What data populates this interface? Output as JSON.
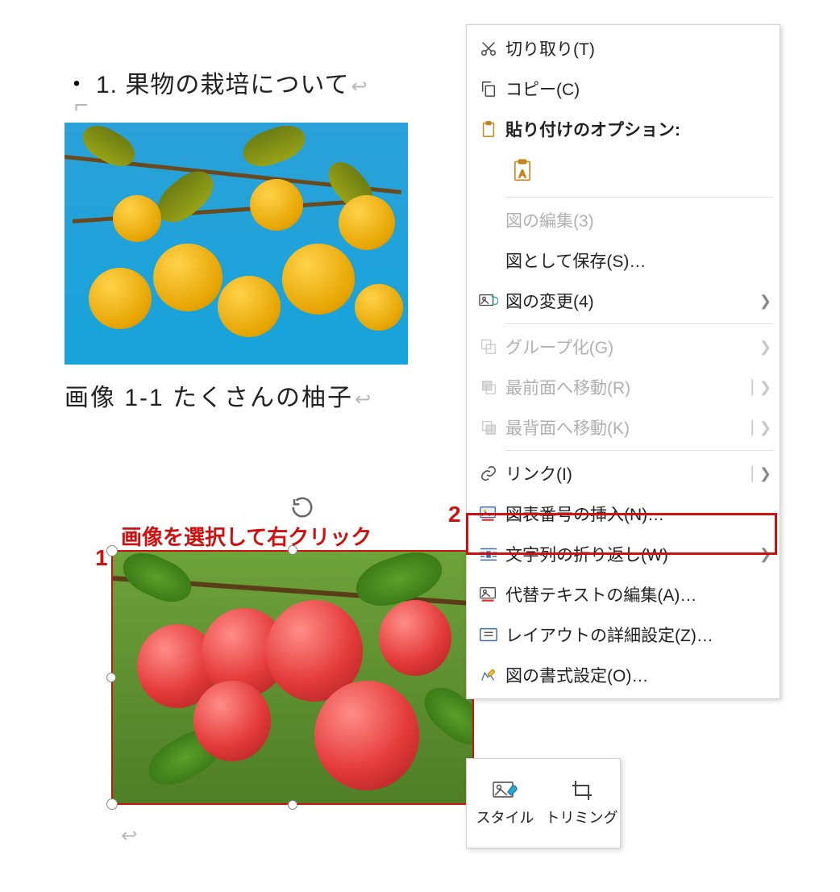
{
  "doc": {
    "heading_text": "1. 果物の栽培について",
    "caption_text": "画像  1-1 たくさんの柚子",
    "return_glyph": "↵"
  },
  "annotation": {
    "label": "画像を選択して右クリック",
    "num1": "1",
    "num2": "2"
  },
  "menu": {
    "cut": "切り取り(T)",
    "copy": "コピー(C)",
    "paste_header": "貼り付けのオプション:",
    "edit_picture": "図の編集(3)",
    "save_as_picture": "図として保存(S)…",
    "change_picture": "図の変更(4)",
    "group": "グループ化(G)",
    "bring_front": "最前面へ移動(R)",
    "send_back": "最背面へ移動(K)",
    "link": "リンク(I)",
    "insert_caption": "図表番号の挿入(N)…",
    "wrap_text": "文字列の折り返し(W)",
    "edit_alt_text": "代替テキストの編集(A)…",
    "size_position": "レイアウトの詳細設定(Z)…",
    "format_picture": "図の書式設定(O)…"
  },
  "mini_toolbar": {
    "style": "スタイル",
    "crop": "トリミング"
  }
}
